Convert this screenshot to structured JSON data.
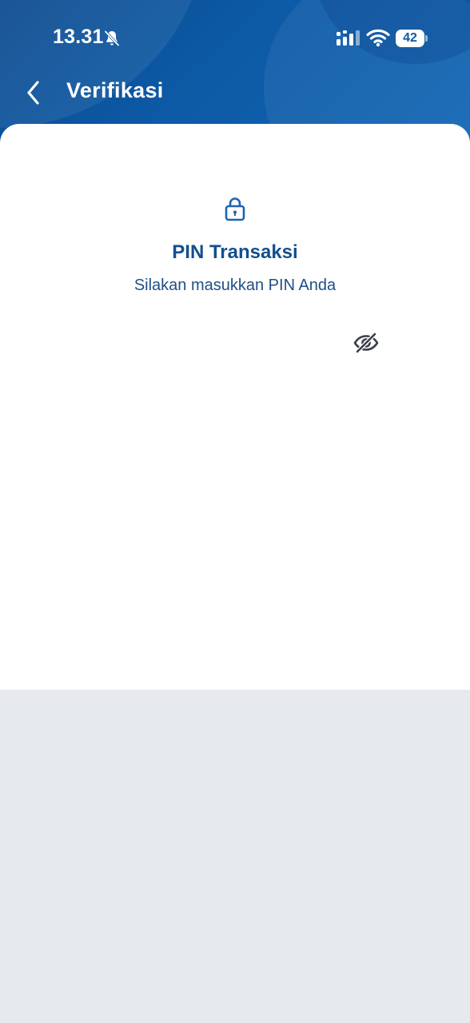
{
  "status_bar": {
    "time": "13.31",
    "battery_level": "42",
    "icons": [
      "bell-muted-icon",
      "signal-icon",
      "wifi-icon",
      "battery-icon"
    ]
  },
  "header": {
    "title": "Verifikasi",
    "back_icon": "chevron-left-icon"
  },
  "pin": {
    "lock_icon": "lock-icon",
    "title": "PIN Transaksi",
    "subtitle": "Silakan masukkan PIN Anda",
    "visibility_icon": "eye-off-icon"
  },
  "colors": {
    "header_blue": "#0d5aa6",
    "title_blue": "#134f8d",
    "text_blue": "#1f4f85",
    "icon_gray": "#3a3f47",
    "bottom_gray": "#e6e9ee"
  }
}
